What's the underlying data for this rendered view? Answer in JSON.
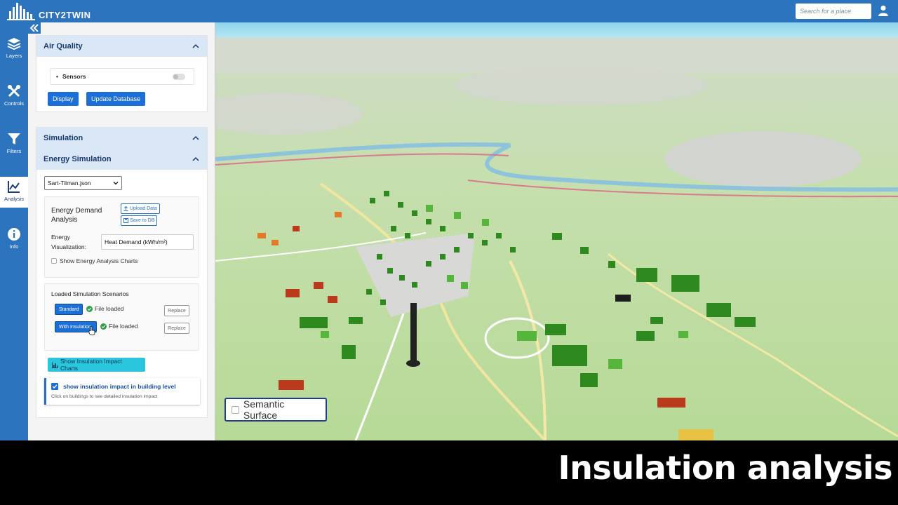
{
  "app": {
    "title": "CITY2TWIN"
  },
  "search": {
    "placeholder": "Search for a place"
  },
  "rail": {
    "items": [
      {
        "label": "Layers",
        "icon": "layers-icon"
      },
      {
        "label": "Controls",
        "icon": "tools-icon"
      },
      {
        "label": "Filters",
        "icon": "filter-icon"
      },
      {
        "label": "Analysis",
        "icon": "chart-icon",
        "active": true
      },
      {
        "label": "Info",
        "icon": "info-icon"
      }
    ]
  },
  "air_quality": {
    "title": "Air Quality",
    "sensors_label": "Sensors",
    "display_btn": "Display",
    "update_btn": "Update Database"
  },
  "simulation": {
    "title": "Simulation",
    "energy_title": "Energy Simulation",
    "file_select": "Sart-Tilman.json",
    "demand_title_1": "Energy Demand",
    "demand_title_2": "Analysis",
    "upload_btn": "Upload Data",
    "save_btn": "Save to DB",
    "viz_label_1": "Energy",
    "viz_label_2": "Visualization:",
    "viz_value": "Heat Demand (kWh/m²)",
    "show_charts_label": "Show Energy Analysis Charts",
    "scenarios_title": "Loaded Simulation Scenarios",
    "scenarios": [
      {
        "name": "Standard",
        "status": "File loaded",
        "action": "Replace"
      },
      {
        "name": "With Insulation",
        "status": "File loaded",
        "action": "Replace"
      }
    ],
    "impact_charts_btn": "Show Insulation Impact Charts",
    "building_level_label": "show insulation impact in building level",
    "building_level_hint": "Click on buildings to see detailed insulation impact"
  },
  "map": {
    "semantic_surface_label": "Semantic Surface"
  },
  "caption": {
    "text": "Insulation analysis"
  },
  "colors": {
    "primary": "#2c74be",
    "button": "#1b6fd6",
    "cyan": "#29c6de",
    "header": "#d9e7f7"
  }
}
